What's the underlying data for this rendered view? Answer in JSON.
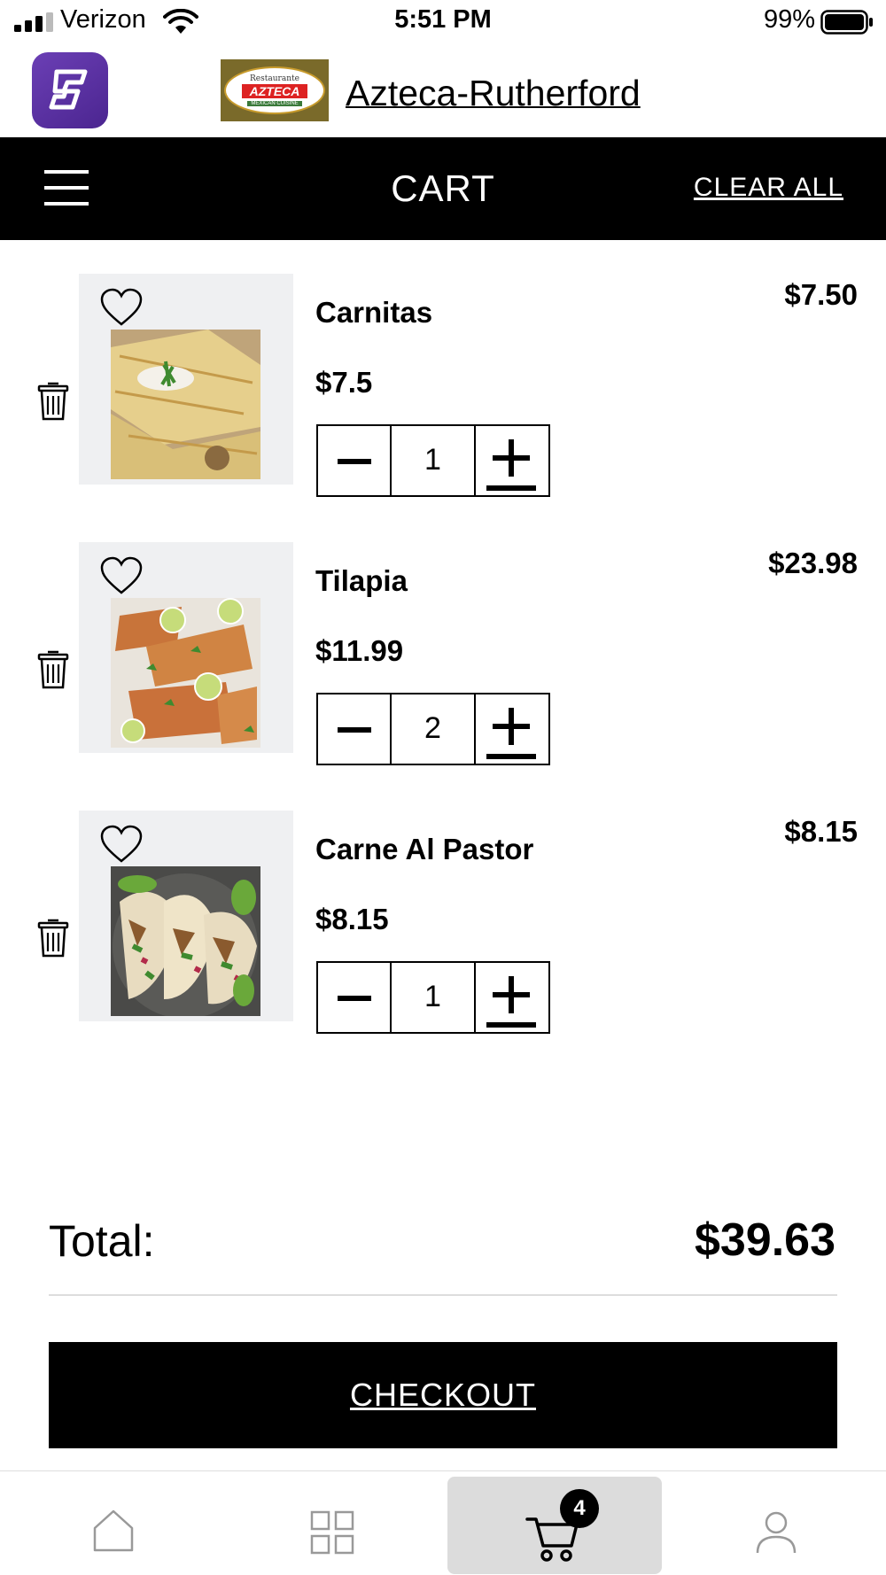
{
  "status_bar": {
    "carrier": "Verizon",
    "time": "5:51 PM",
    "battery": "99%",
    "signal_icon": "signal-icon",
    "wifi_icon": "wifi-icon",
    "battery_icon": "battery-icon"
  },
  "header": {
    "restaurant_name": "Azteca-Rutherford",
    "logo_text": {
      "line1": "Restaurante",
      "line2": "AZTECA",
      "line3": "MEXICAN CUISINE"
    }
  },
  "nav": {
    "title": "CART",
    "clear_all": "CLEAR ALL"
  },
  "cart": {
    "items": [
      {
        "name": "Carnitas",
        "price": "$7.5",
        "quantity": "1",
        "line_total": "$7.50"
      },
      {
        "name": "Tilapia",
        "price": "$11.99",
        "quantity": "2",
        "line_total": "$23.98"
      },
      {
        "name": "Carne Al Pastor",
        "price": "$8.15",
        "quantity": "1",
        "line_total": "$8.15"
      }
    ],
    "total_label": "Total:",
    "total_value": "$39.63",
    "checkout_label": "CHECKOUT"
  },
  "tab_bar": {
    "tabs": [
      {
        "icon": "home-icon",
        "active": false
      },
      {
        "icon": "grid-icon",
        "active": false
      },
      {
        "icon": "cart-icon",
        "active": true
      },
      {
        "icon": "user-icon",
        "active": false
      }
    ],
    "cart_badge": "4"
  },
  "colors": {
    "primary": "#000000",
    "app_logo": "#5a31a3",
    "thumb_bg": "#eff0f2",
    "active_tab_bg": "#dcdcdc"
  }
}
